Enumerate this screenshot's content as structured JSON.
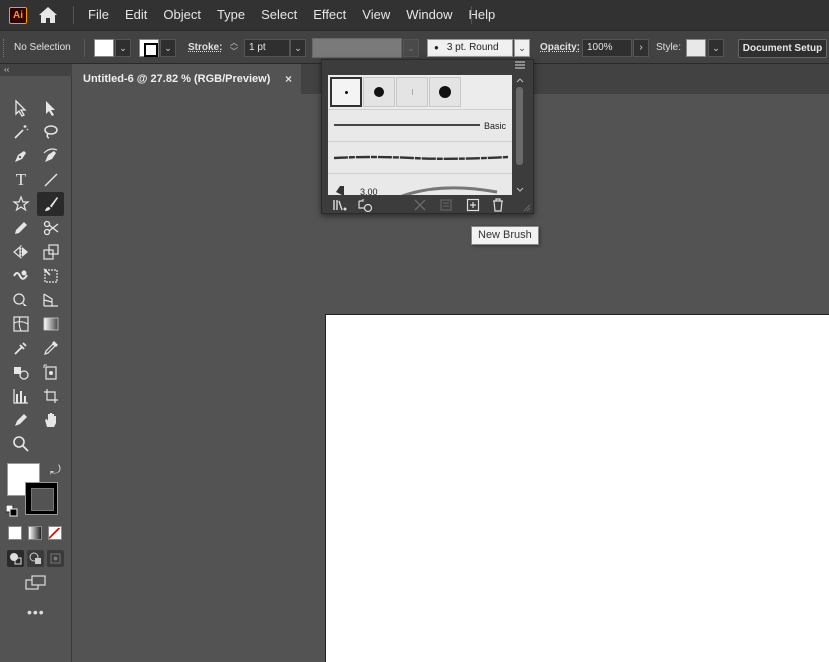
{
  "app": {
    "logo_text": "Ai",
    "brand_color": "#ff9a00"
  },
  "menu": {
    "items": [
      "File",
      "Edit",
      "Object",
      "Type",
      "Select",
      "Effect",
      "View",
      "Window",
      "Help"
    ]
  },
  "control_bar": {
    "selection_status": "No Selection",
    "stroke_label": "Stroke:",
    "stroke_weight": "1 pt",
    "brush_value": "3 pt. Round",
    "opacity_label": "Opacity:",
    "opacity_value": "100%",
    "style_label": "Style:",
    "document_setup_label": "Document Setup"
  },
  "document_tab": {
    "title": "Untitled-6 @ 27.82 % (RGB/Preview)",
    "close_glyph": "×"
  },
  "brush_panel": {
    "basic_label": "Basic",
    "partial_row_value": "3.00",
    "tooltip": "New Brush"
  },
  "tool_panel": {
    "collapse_glyph": "‹‹",
    "more_tools_glyph": "•••"
  }
}
